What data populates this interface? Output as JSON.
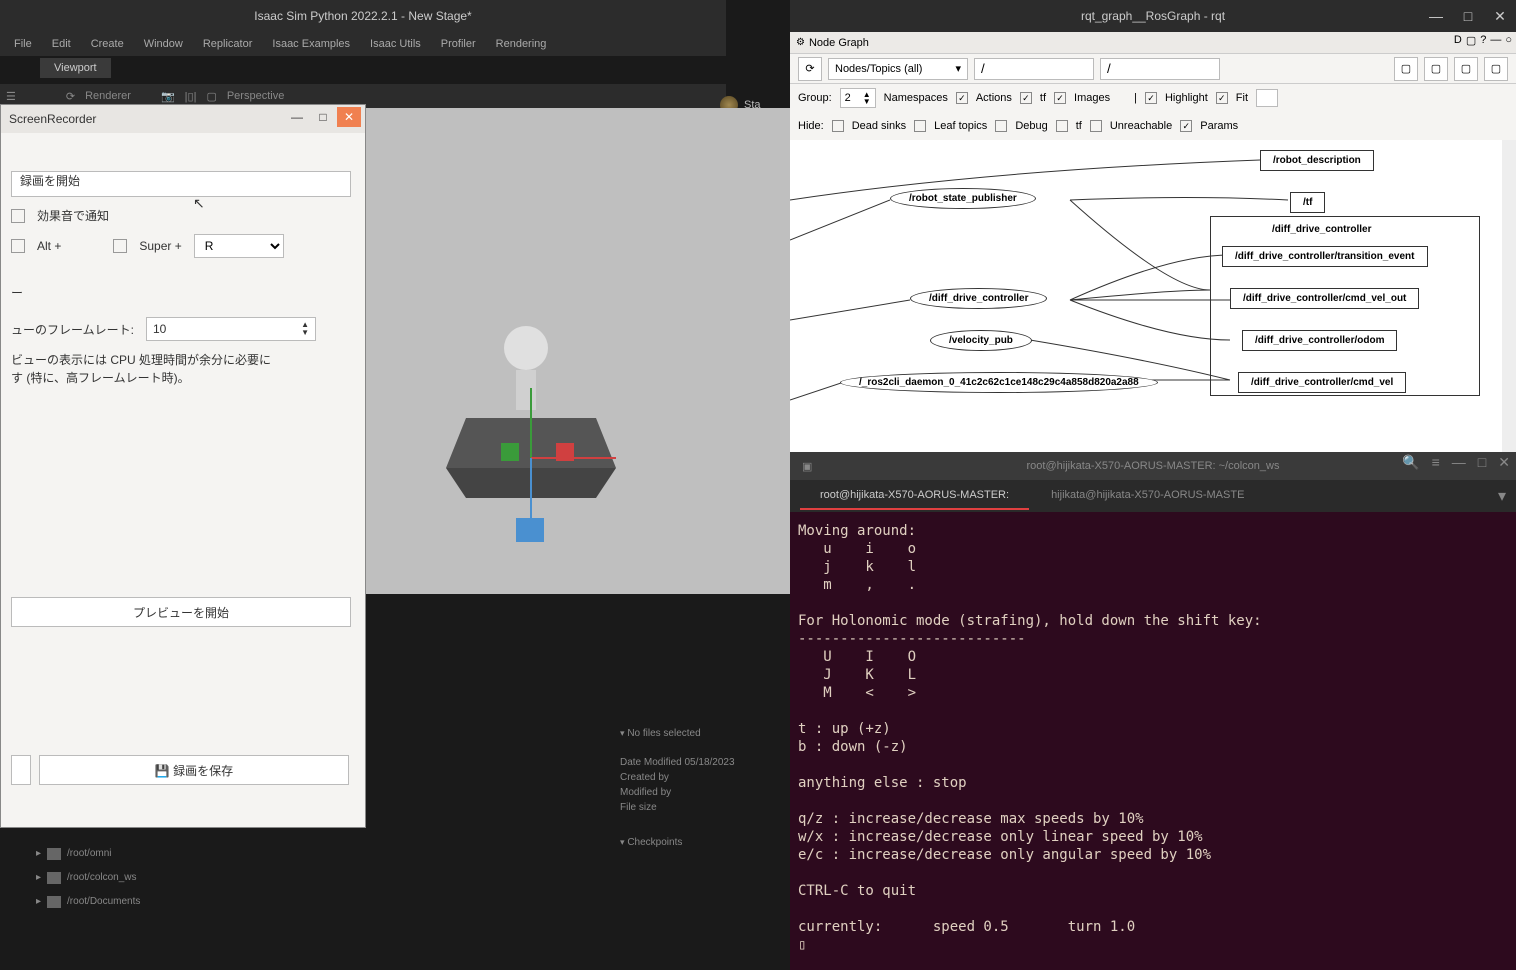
{
  "isaac": {
    "title": "Isaac Sim Python 2022.2.1 - New Stage*",
    "menu": [
      "File",
      "Edit",
      "Create",
      "Window",
      "Replicator",
      "Isaac Examples",
      "Isaac Utils",
      "Profiler",
      "Rendering"
    ],
    "viewport_tab": "Viewport",
    "sub_item1": "Renderer",
    "sub_item2": "Perspective",
    "stage_label": "Sta"
  },
  "sr": {
    "title": "ScreenRecorder",
    "start_label": "録画を開始",
    "notify_label": "効果音で通知",
    "hotkey_alt": "Alt +",
    "hotkey_super": "Super +",
    "hotkey_r": "R",
    "section2": "ー",
    "fr_label": "ューのフレームレート:",
    "fr_value": "10",
    "note1": "ビューの表示には CPU 処理時間が余分に必要に",
    "note2": "す (特に、高フレームレート時)。",
    "preview_btn": "プレビューを開始",
    "save_btn": "💾 録画を保存"
  },
  "rqt": {
    "title": "rqt_graph__RosGraph - rqt",
    "tab": "Node Graph",
    "refresh_icon": "⟳",
    "mode": "Nodes/Topics (all)",
    "filter1": "/",
    "filter2": "/",
    "group_label": "Group:",
    "group_value": "2",
    "namespaces": "Namespaces",
    "options": [
      {
        "label": "Actions",
        "on": true
      },
      {
        "label": "tf",
        "on": true
      },
      {
        "label": "Images",
        "on": true
      }
    ],
    "highlight_label": "Highlight",
    "fit_label": "Fit",
    "hide_label": "Hide:",
    "hide_opts": [
      {
        "label": "Dead sinks",
        "on": false
      },
      {
        "label": "Leaf topics",
        "on": false
      },
      {
        "label": "Debug",
        "on": false
      },
      {
        "label": "tf",
        "on": false
      },
      {
        "label": "Unreachable",
        "on": false
      },
      {
        "label": "Params",
        "on": true
      }
    ],
    "nodes": {
      "robot_state_publisher": "/robot_state_publisher",
      "diff_drive_controller": "/diff_drive_controller",
      "velocity_pub": "/velocity_pub",
      "ros2cli": "/_ros2cli_daemon_0_41c2c62c1ce148c29c4a858d820a2a88"
    },
    "topics": {
      "robot_description": "/robot_description",
      "tf": "/tf",
      "diff_ctrl_group": "/diff_drive_controller",
      "transition": "/diff_drive_controller/transition_event",
      "cmd_vel_out": "/diff_drive_controller/cmd_vel_out",
      "odom": "/diff_drive_controller/odom",
      "cmd_vel": "/diff_drive_controller/cmd_vel"
    }
  },
  "content": {
    "no_files": "No files selected",
    "date_mod": "Date Modified 05/18/2023",
    "created_by": "Created by",
    "modified_by": "Modified by",
    "file_size": "File size",
    "checkpoints": "Checkpoints",
    "paths": [
      "/root/omni",
      "/root/colcon_ws",
      "/root/Documents"
    ]
  },
  "term": {
    "title": "root@hijikata-X570-AORUS-MASTER: ~/colcon_ws",
    "tab1": "root@hijikata-X570-AORUS-MASTER:",
    "tab2": "hijikata@hijikata-X570-AORUS-MASTE",
    "body": "Moving around:\n   u    i    o\n   j    k    l\n   m    ,    .\n\nFor Holonomic mode (strafing), hold down the shift key:\n---------------------------\n   U    I    O\n   J    K    L\n   M    <    >\n\nt : up (+z)\nb : down (-z)\n\nanything else : stop\n\nq/z : increase/decrease max speeds by 10%\nw/x : increase/decrease only linear speed by 10%\ne/c : increase/decrease only angular speed by 10%\n\nCTRL-C to quit\n\ncurrently:\tspeed 0.5\tturn 1.0\n▯"
  }
}
